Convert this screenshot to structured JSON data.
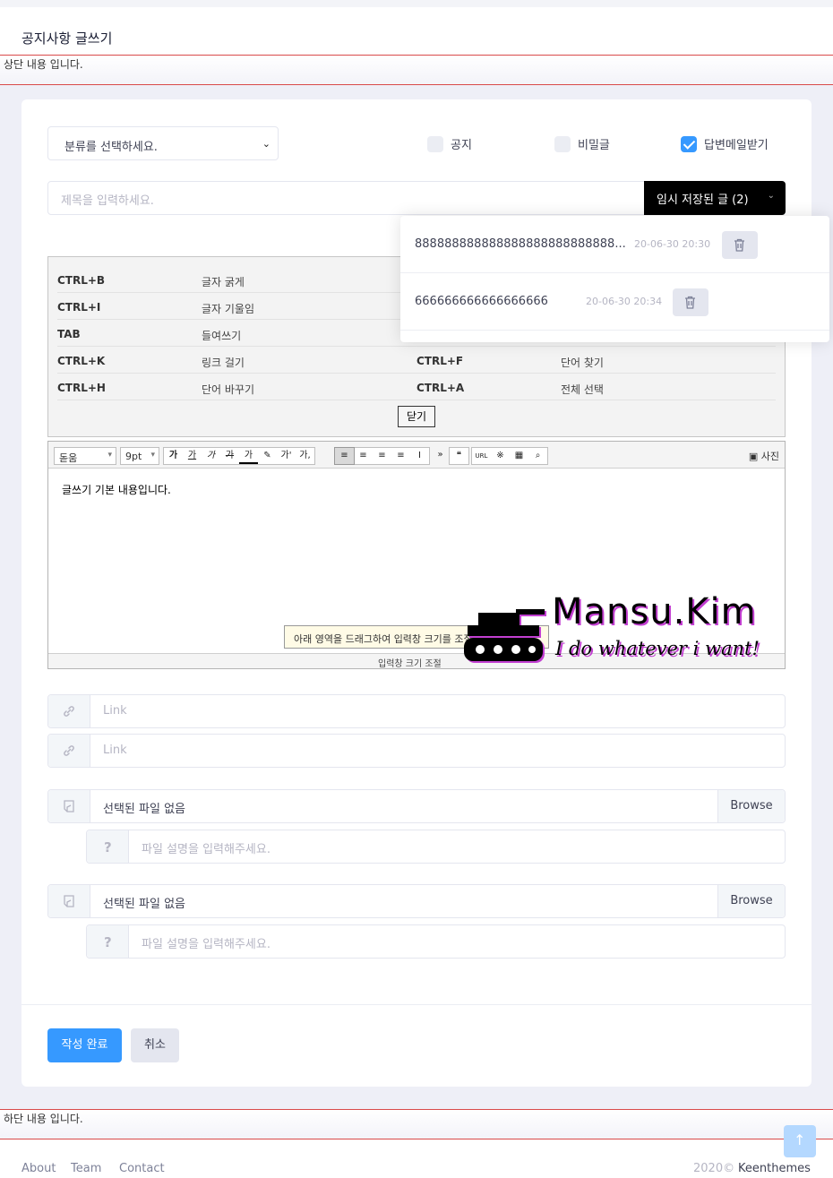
{
  "header": {
    "title": "공지사항 글쓰기"
  },
  "top_banner": {
    "text": "상단 내용 입니다."
  },
  "bottom_banner": {
    "text": "하단 내용 입니다."
  },
  "form": {
    "category_select": "분류를 선택하세요.",
    "checkbox_notice": "공지",
    "checkbox_secret": "비밀글",
    "checkbox_reply_mail": "답변메일받기",
    "reply_mail_checked": true,
    "title_placeholder": "제목을 입력하세요.",
    "draft_button": "임시 저장된 글 (2)"
  },
  "drafts": [
    {
      "title": "888888888888888888888888888...",
      "date": "20-06-30 20:30"
    },
    {
      "title": "666666666666666666",
      "date": "20-06-30 20:34"
    }
  ],
  "shortcuts": {
    "rows": [
      {
        "key1": "CTRL+B",
        "desc1": "글자 굵게",
        "key2": "",
        "desc2": ""
      },
      {
        "key1": "CTRL+I",
        "desc1": "글자 기울임",
        "key2": "",
        "desc2": ""
      },
      {
        "key1": "TAB",
        "desc1": "들여쓰기",
        "key2": "",
        "desc2": ""
      },
      {
        "key1": "CTRL+K",
        "desc1": "링크 걸기",
        "key2": "CTRL+F",
        "desc2": "단어 찾기"
      },
      {
        "key1": "CTRL+H",
        "desc1": "단어 바꾸기",
        "key2": "CTRL+A",
        "desc2": "전체 선택"
      }
    ],
    "close_label": "닫기"
  },
  "editor": {
    "font": "돋움",
    "size": "9pt",
    "photo_label": "사진",
    "content": "글쓰기 기본 내용입니다.",
    "tooltip": "아래 영역을 드래그하여 입력창 크기를 조절할 수 있습니다.",
    "resize_label": "입력창 크기 조절",
    "toolbar_buttons": [
      "가",
      "가",
      "가",
      "가",
      "가",
      "가'",
      "가,",
      "≡",
      "≡",
      "≡",
      "≡",
      "I",
      "»",
      "❝",
      "URL",
      "※",
      "▦",
      "🔍"
    ]
  },
  "watermark": {
    "title": "Mansu.Kim",
    "subtitle": "I do whatever i want!"
  },
  "links": [
    {
      "placeholder": "Link"
    },
    {
      "placeholder": "Link"
    }
  ],
  "files": [
    {
      "file_label": "선택된 파일 없음",
      "browse": "Browse",
      "desc_placeholder": "파일 설명을 입력해주세요."
    },
    {
      "file_label": "선택된 파일 없음",
      "browse": "Browse",
      "desc_placeholder": "파일 설명을 입력해주세요."
    }
  ],
  "actions": {
    "submit": "작성 완료",
    "cancel": "취소"
  },
  "footer": {
    "links": [
      "About",
      "Team",
      "Contact"
    ],
    "year": "2020©",
    "company": "Keenthemes"
  },
  "colors": {
    "primary": "#3699ff",
    "banner_border": "#d94a4a",
    "watermark_accent": "#c23fd1"
  }
}
